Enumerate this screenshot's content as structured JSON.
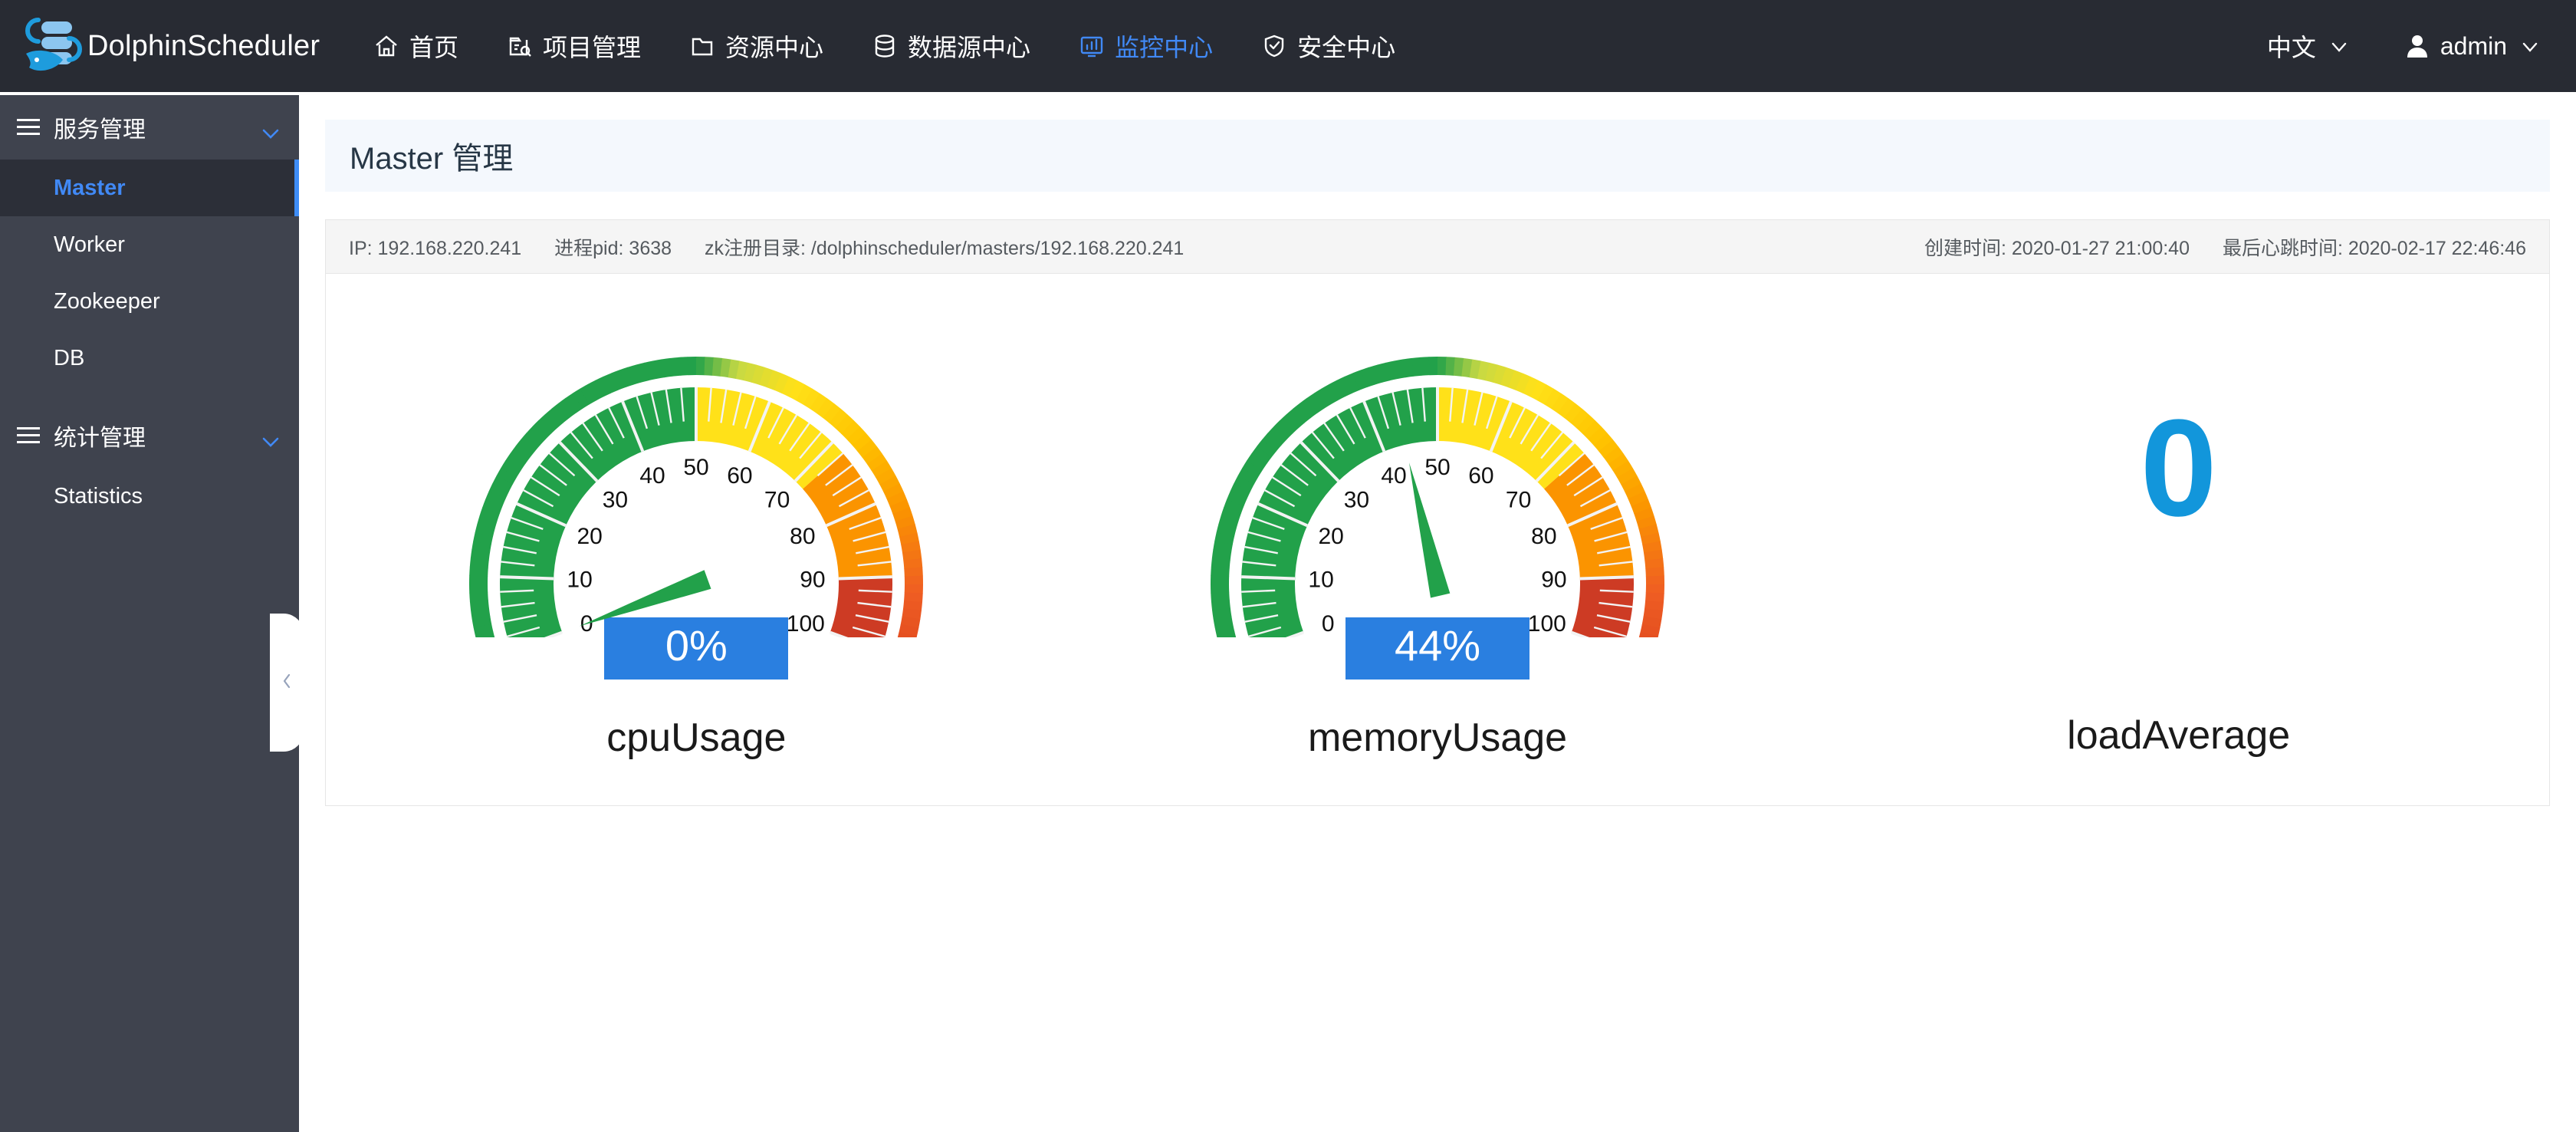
{
  "navbar": {
    "brand": "DolphinScheduler",
    "brand_logo_icon": "dolphin-logo-icon",
    "items": [
      {
        "label": "首页",
        "icon": "home-icon",
        "active": false
      },
      {
        "label": "项目管理",
        "icon": "project-icon",
        "active": false
      },
      {
        "label": "资源中心",
        "icon": "folder-icon",
        "active": false
      },
      {
        "label": "数据源中心",
        "icon": "database-icon",
        "active": false
      },
      {
        "label": "监控中心",
        "icon": "monitor-icon",
        "active": true
      },
      {
        "label": "安全中心",
        "icon": "shield-icon",
        "active": false
      }
    ],
    "language": "中文",
    "language_chevron_icon": "chevron-down-icon",
    "user": "admin",
    "user_icon": "user-icon",
    "user_chevron_icon": "chevron-down-icon",
    "active_color": "#4189f5",
    "background": "#282b33"
  },
  "sidebar": {
    "background": "#3f434e",
    "active_color": "#4189f5",
    "collapse_handle_icon": "chevron-left-icon",
    "groups": [
      {
        "label": "服务管理",
        "menu_icon": "hamburger-icon",
        "chevron_icon": "chevron-down-icon",
        "items": [
          {
            "label": "Master",
            "active": true
          },
          {
            "label": "Worker",
            "active": false
          },
          {
            "label": "Zookeeper",
            "active": false
          },
          {
            "label": "DB",
            "active": false
          }
        ]
      },
      {
        "label": "统计管理",
        "menu_icon": "hamburger-icon",
        "chevron_icon": "chevron-down-icon",
        "items": [
          {
            "label": "Statistics",
            "active": false
          }
        ]
      }
    ]
  },
  "page": {
    "title": "Master 管理"
  },
  "server_info": {
    "ip_label": "IP: 192.168.220.241",
    "pid_label": "进程pid: 3638",
    "zk_label": "zk注册目录: /dolphinscheduler/masters/192.168.220.241",
    "create_time_label": "创建时间: 2020-01-27 21:00:40",
    "last_heartbeat_label": "最后心跳时间: 2020-02-17 22:46:46"
  },
  "chart_data": [
    {
      "type": "gauge",
      "title": "cpuUsage",
      "value": 0,
      "display_value": "0%",
      "min": 0,
      "max": 100,
      "tick_labels": [
        0,
        10,
        20,
        30,
        40,
        50,
        60,
        70,
        80,
        90,
        100
      ],
      "major_tick_step": 10,
      "minor_tick_step": 2,
      "start_angle": 200,
      "end_angle": -20,
      "needle_color": "#22a14a",
      "badge_color": "#2a7fe0",
      "bands": [
        {
          "from": 0,
          "to": 50,
          "color": "#22a14a"
        },
        {
          "from": 50,
          "to": 72,
          "color": "#ffe119"
        },
        {
          "from": 72,
          "to": 90,
          "color": "#fb9400"
        },
        {
          "from": 90,
          "to": 100,
          "color": "#cd3b24"
        }
      ]
    },
    {
      "type": "gauge",
      "title": "memoryUsage",
      "value": 44,
      "display_value": "44%",
      "min": 0,
      "max": 100,
      "tick_labels": [
        0,
        10,
        20,
        30,
        40,
        50,
        60,
        70,
        80,
        90,
        100
      ],
      "major_tick_step": 10,
      "minor_tick_step": 2,
      "start_angle": 200,
      "end_angle": -20,
      "needle_color": "#22a14a",
      "badge_color": "#2a7fe0",
      "bands": [
        {
          "from": 0,
          "to": 50,
          "color": "#22a14a"
        },
        {
          "from": 50,
          "to": 72,
          "color": "#ffe119"
        },
        {
          "from": 72,
          "to": 90,
          "color": "#fb9400"
        },
        {
          "from": 90,
          "to": 100,
          "color": "#cd3b24"
        }
      ]
    },
    {
      "type": "number",
      "title": "loadAverage",
      "value": 0,
      "display_value": "0",
      "color": "#1296db"
    }
  ]
}
